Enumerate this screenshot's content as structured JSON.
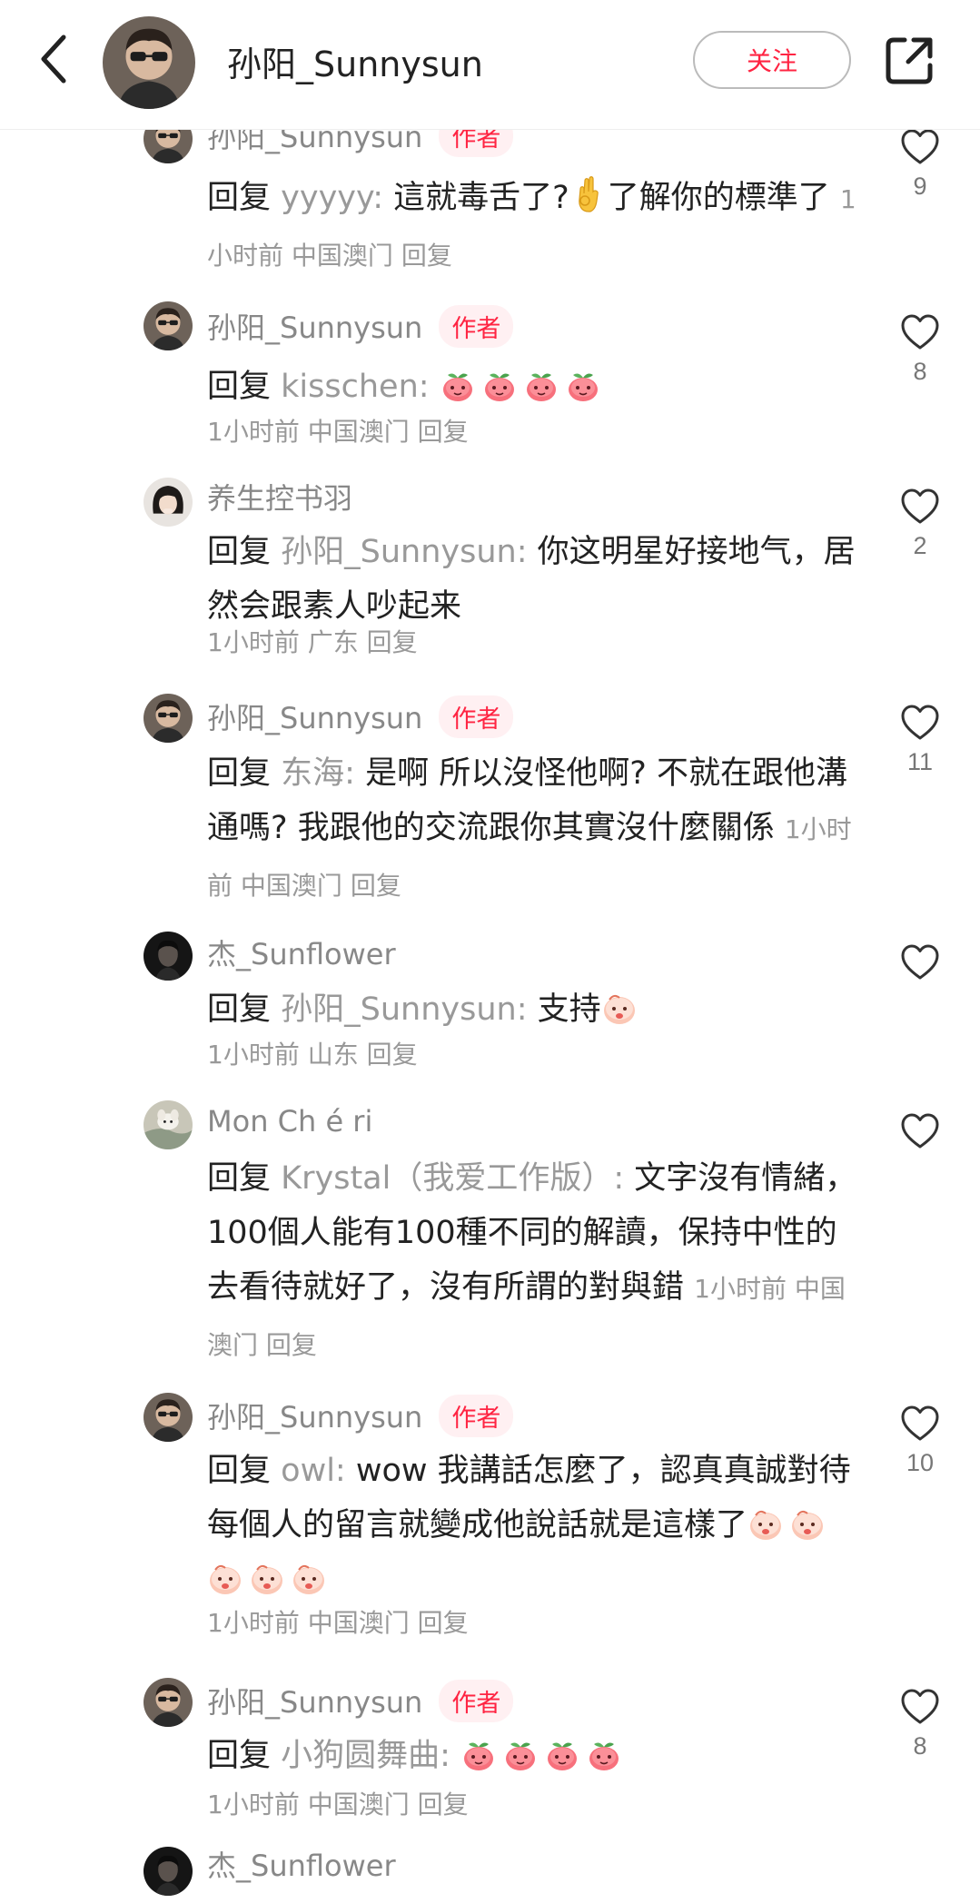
{
  "header": {
    "username": "孙阳_Sunnysun",
    "follow_label": "关注"
  },
  "labels": {
    "reply": "回复",
    "author_tag": "作者",
    "reply_action": "回复",
    "colon": ":"
  },
  "comments": [
    {
      "user": "孙阳_Sunnysun",
      "is_author": true,
      "reply_to": "yyyyy",
      "text_before": "這就毒舌了?",
      "text_after": "了解你的標準了",
      "time": "1小时前",
      "location": "中国澳门",
      "likes": "9"
    },
    {
      "user": "孙阳_Sunnysun",
      "is_author": true,
      "reply_to": "kisschen",
      "text": "",
      "time": "1小时前",
      "location": "中国澳门",
      "likes": "8"
    },
    {
      "user": "养生控书羽",
      "is_author": false,
      "reply_to": "孙阳_Sunnysun",
      "text": "你这明星好接地气，居然会跟素人吵起来",
      "time": "1小时前",
      "location": "广东",
      "likes": "2"
    },
    {
      "user": "孙阳_Sunnysun",
      "is_author": true,
      "reply_to": "东海",
      "text": "是啊 所以沒怪他啊? 不就在跟他溝通嗎? 我跟他的交流跟你其實沒什麼關係",
      "time": "1小时前",
      "location": "中国澳门",
      "likes": "11"
    },
    {
      "user": "杰_Sunflower",
      "is_author": false,
      "reply_to": "孙阳_Sunnysun",
      "text": "支持",
      "time": "1小时前",
      "location": "山东",
      "likes": ""
    },
    {
      "user": "Mon Ch é ri",
      "is_author": false,
      "reply_to": "Krystal（我爱工作版）",
      "text": "文字沒有情緒，100個人能有100種不同的解讀，保持中性的去看待就好了，沒有所謂的對與錯",
      "time": "1小时前",
      "location": "中国澳门",
      "likes": ""
    },
    {
      "user": "孙阳_Sunnysun",
      "is_author": true,
      "reply_to": "owl",
      "text": "wow 我講話怎麼了，認真真誠對待每個人的留言就變成他說話就是這樣了",
      "time": "1小时前",
      "location": "中国澳门",
      "likes": "10"
    },
    {
      "user": "孙阳_Sunnysun",
      "is_author": true,
      "reply_to": "小狗圆舞曲",
      "text": "",
      "time": "1小时前",
      "location": "中国澳门",
      "likes": "8"
    },
    {
      "user": "杰_Sunflower",
      "is_author": false
    }
  ],
  "colors": {
    "accent": "#ff2442",
    "author_tag_bg": "#fff0f2",
    "secondary_text": "#999999",
    "primary_text": "#222222"
  },
  "icons": {
    "back": "chevron-left-icon",
    "share": "share-icon",
    "like": "heart-outline-icon",
    "emoji_ok": "ok-hand-emoji",
    "emoji_sticker": "peach-sticker-icon"
  }
}
